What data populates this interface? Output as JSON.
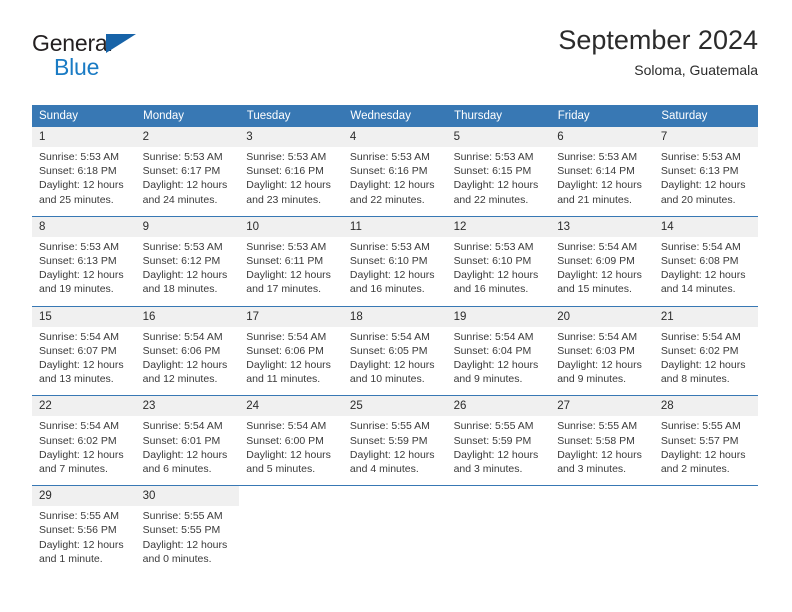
{
  "logo": {
    "part1": "General",
    "part2": "Blue",
    "triangle_color": "#1763a8",
    "blue_color": "#1a7bc4"
  },
  "header": {
    "title": "September 2024",
    "location": "Soloma, Guatemala"
  },
  "theme": {
    "header_bg": "#3878b4",
    "daynum_bg": "#f0f0f0",
    "text": "#3a3a3a"
  },
  "weekdays": [
    "Sunday",
    "Monday",
    "Tuesday",
    "Wednesday",
    "Thursday",
    "Friday",
    "Saturday"
  ],
  "weeks": [
    {
      "days": [
        {
          "num": "1",
          "sunrise": "Sunrise: 5:53 AM",
          "sunset": "Sunset: 6:18 PM",
          "daylight1": "Daylight: 12 hours",
          "daylight2": "and 25 minutes."
        },
        {
          "num": "2",
          "sunrise": "Sunrise: 5:53 AM",
          "sunset": "Sunset: 6:17 PM",
          "daylight1": "Daylight: 12 hours",
          "daylight2": "and 24 minutes."
        },
        {
          "num": "3",
          "sunrise": "Sunrise: 5:53 AM",
          "sunset": "Sunset: 6:16 PM",
          "daylight1": "Daylight: 12 hours",
          "daylight2": "and 23 minutes."
        },
        {
          "num": "4",
          "sunrise": "Sunrise: 5:53 AM",
          "sunset": "Sunset: 6:16 PM",
          "daylight1": "Daylight: 12 hours",
          "daylight2": "and 22 minutes."
        },
        {
          "num": "5",
          "sunrise": "Sunrise: 5:53 AM",
          "sunset": "Sunset: 6:15 PM",
          "daylight1": "Daylight: 12 hours",
          "daylight2": "and 22 minutes."
        },
        {
          "num": "6",
          "sunrise": "Sunrise: 5:53 AM",
          "sunset": "Sunset: 6:14 PM",
          "daylight1": "Daylight: 12 hours",
          "daylight2": "and 21 minutes."
        },
        {
          "num": "7",
          "sunrise": "Sunrise: 5:53 AM",
          "sunset": "Sunset: 6:13 PM",
          "daylight1": "Daylight: 12 hours",
          "daylight2": "and 20 minutes."
        }
      ]
    },
    {
      "days": [
        {
          "num": "8",
          "sunrise": "Sunrise: 5:53 AM",
          "sunset": "Sunset: 6:13 PM",
          "daylight1": "Daylight: 12 hours",
          "daylight2": "and 19 minutes."
        },
        {
          "num": "9",
          "sunrise": "Sunrise: 5:53 AM",
          "sunset": "Sunset: 6:12 PM",
          "daylight1": "Daylight: 12 hours",
          "daylight2": "and 18 minutes."
        },
        {
          "num": "10",
          "sunrise": "Sunrise: 5:53 AM",
          "sunset": "Sunset: 6:11 PM",
          "daylight1": "Daylight: 12 hours",
          "daylight2": "and 17 minutes."
        },
        {
          "num": "11",
          "sunrise": "Sunrise: 5:53 AM",
          "sunset": "Sunset: 6:10 PM",
          "daylight1": "Daylight: 12 hours",
          "daylight2": "and 16 minutes."
        },
        {
          "num": "12",
          "sunrise": "Sunrise: 5:53 AM",
          "sunset": "Sunset: 6:10 PM",
          "daylight1": "Daylight: 12 hours",
          "daylight2": "and 16 minutes."
        },
        {
          "num": "13",
          "sunrise": "Sunrise: 5:54 AM",
          "sunset": "Sunset: 6:09 PM",
          "daylight1": "Daylight: 12 hours",
          "daylight2": "and 15 minutes."
        },
        {
          "num": "14",
          "sunrise": "Sunrise: 5:54 AM",
          "sunset": "Sunset: 6:08 PM",
          "daylight1": "Daylight: 12 hours",
          "daylight2": "and 14 minutes."
        }
      ]
    },
    {
      "days": [
        {
          "num": "15",
          "sunrise": "Sunrise: 5:54 AM",
          "sunset": "Sunset: 6:07 PM",
          "daylight1": "Daylight: 12 hours",
          "daylight2": "and 13 minutes."
        },
        {
          "num": "16",
          "sunrise": "Sunrise: 5:54 AM",
          "sunset": "Sunset: 6:06 PM",
          "daylight1": "Daylight: 12 hours",
          "daylight2": "and 12 minutes."
        },
        {
          "num": "17",
          "sunrise": "Sunrise: 5:54 AM",
          "sunset": "Sunset: 6:06 PM",
          "daylight1": "Daylight: 12 hours",
          "daylight2": "and 11 minutes."
        },
        {
          "num": "18",
          "sunrise": "Sunrise: 5:54 AM",
          "sunset": "Sunset: 6:05 PM",
          "daylight1": "Daylight: 12 hours",
          "daylight2": "and 10 minutes."
        },
        {
          "num": "19",
          "sunrise": "Sunrise: 5:54 AM",
          "sunset": "Sunset: 6:04 PM",
          "daylight1": "Daylight: 12 hours",
          "daylight2": "and 9 minutes."
        },
        {
          "num": "20",
          "sunrise": "Sunrise: 5:54 AM",
          "sunset": "Sunset: 6:03 PM",
          "daylight1": "Daylight: 12 hours",
          "daylight2": "and 9 minutes."
        },
        {
          "num": "21",
          "sunrise": "Sunrise: 5:54 AM",
          "sunset": "Sunset: 6:02 PM",
          "daylight1": "Daylight: 12 hours",
          "daylight2": "and 8 minutes."
        }
      ]
    },
    {
      "days": [
        {
          "num": "22",
          "sunrise": "Sunrise: 5:54 AM",
          "sunset": "Sunset: 6:02 PM",
          "daylight1": "Daylight: 12 hours",
          "daylight2": "and 7 minutes."
        },
        {
          "num": "23",
          "sunrise": "Sunrise: 5:54 AM",
          "sunset": "Sunset: 6:01 PM",
          "daylight1": "Daylight: 12 hours",
          "daylight2": "and 6 minutes."
        },
        {
          "num": "24",
          "sunrise": "Sunrise: 5:54 AM",
          "sunset": "Sunset: 6:00 PM",
          "daylight1": "Daylight: 12 hours",
          "daylight2": "and 5 minutes."
        },
        {
          "num": "25",
          "sunrise": "Sunrise: 5:55 AM",
          "sunset": "Sunset: 5:59 PM",
          "daylight1": "Daylight: 12 hours",
          "daylight2": "and 4 minutes."
        },
        {
          "num": "26",
          "sunrise": "Sunrise: 5:55 AM",
          "sunset": "Sunset: 5:59 PM",
          "daylight1": "Daylight: 12 hours",
          "daylight2": "and 3 minutes."
        },
        {
          "num": "27",
          "sunrise": "Sunrise: 5:55 AM",
          "sunset": "Sunset: 5:58 PM",
          "daylight1": "Daylight: 12 hours",
          "daylight2": "and 3 minutes."
        },
        {
          "num": "28",
          "sunrise": "Sunrise: 5:55 AM",
          "sunset": "Sunset: 5:57 PM",
          "daylight1": "Daylight: 12 hours",
          "daylight2": "and 2 minutes."
        }
      ]
    },
    {
      "days": [
        {
          "num": "29",
          "sunrise": "Sunrise: 5:55 AM",
          "sunset": "Sunset: 5:56 PM",
          "daylight1": "Daylight: 12 hours",
          "daylight2": "and 1 minute."
        },
        {
          "num": "30",
          "sunrise": "Sunrise: 5:55 AM",
          "sunset": "Sunset: 5:55 PM",
          "daylight1": "Daylight: 12 hours",
          "daylight2": "and 0 minutes."
        },
        {
          "num": "",
          "sunrise": "",
          "sunset": "",
          "daylight1": "",
          "daylight2": ""
        },
        {
          "num": "",
          "sunrise": "",
          "sunset": "",
          "daylight1": "",
          "daylight2": ""
        },
        {
          "num": "",
          "sunrise": "",
          "sunset": "",
          "daylight1": "",
          "daylight2": ""
        },
        {
          "num": "",
          "sunrise": "",
          "sunset": "",
          "daylight1": "",
          "daylight2": ""
        },
        {
          "num": "",
          "sunrise": "",
          "sunset": "",
          "daylight1": "",
          "daylight2": ""
        }
      ]
    }
  ]
}
